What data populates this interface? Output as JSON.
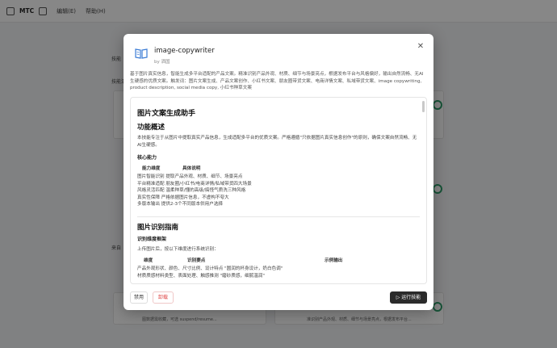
{
  "app": {
    "name": "MTC",
    "menu_edit": "编辑(E)",
    "menu_help": "帮助(H)",
    "bg_left_1": "技能",
    "bg_left_2": "技能清单",
    "bg_left_3": "来自",
    "bg_note_1": "图数据需收藏，可选 suspend/resume...",
    "bg_note_2": "准识别产品外观、材质、细节与场景亮点，根据发布平台..."
  },
  "modal": {
    "title": "image-copywriter",
    "author": "by 洒国",
    "description": "基于图片真实信息，智能生成多平台适配的产品文案。精准识别产品外观、材质、细节与场景亮点，根据发布平台与风格偏好，输出自然流畅、无AI生硬感的优质文案。触发词：图片文案生成、产品文案创作、小红书文案、朋友圈带货文案、电商详情文案、私域带货文案、image copywriting, product description, social media copy, 小红书种草文案",
    "doc": {
      "h1": "图片文案生成助手",
      "overview_title": "功能概述",
      "overview_text": "本技能专注于从图片中提取真实产品信息，生成适配多平台的优质文案。严格遵循\"只依据图片真实信息创作\"的原则，确保文案自然流畅、无AI生硬感。",
      "core_title": "核心能力",
      "core_header": {
        "col1": "能力维度",
        "col2": "具体说明"
      },
      "core_rows": [
        "图片智能识别 提取产品外观、材质、细节、场景亮点",
        "平台精准适配 朋友圈/小红书/电商详情/私域带货四大场景",
        "风格灵活匹配 温柔种草/懂的高级/搞怪气质洗三种风格",
        "真实性保障  严格依据图片信息，不虚构不夸大",
        "多版本输出  提供2-3个不同版本供用户选择"
      ],
      "guide_title": "图片识别指南",
      "frame_title": "识别维度框架",
      "frame_text": "上传图片后，按以下维度进行系统识别：",
      "frame_header": {
        "col1": "维度",
        "col2": "识别要点",
        "col3": "示例输出"
      },
      "frame_rows": [
        "产品外观形状、颜色、尺寸比例、设计特点 \"圆润的杯身设计，奶白色调\"",
        "材质质感材料类型、表面处理、触感推测 \"磨砂质感，细腻温润\""
      ]
    },
    "buttons": {
      "disable": "禁用",
      "uninstall": "卸载",
      "run": "运行技能"
    }
  },
  "colors": {
    "accent_dark": "#2b2b2b",
    "danger": "#e04848",
    "toggle_green": "#2f9e6a",
    "icon_blue": "#3a7bd5"
  }
}
